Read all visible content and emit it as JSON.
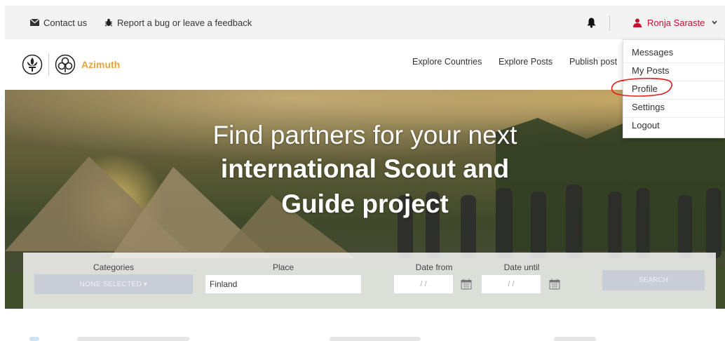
{
  "topbar": {
    "contact_label": "Contact us",
    "bug_label": "Report a bug or leave a feedback",
    "user_name": "Ronja Saraste"
  },
  "navbar": {
    "brand": "Azimuth",
    "links": [
      "Explore Countries",
      "Explore Posts",
      "Publish post"
    ]
  },
  "hero": {
    "line1": "Find partners for your next",
    "line2": "international Scout and",
    "line3": "Guide project"
  },
  "search": {
    "categories_label": "Categories",
    "categories_value": "NONE SELECTED ▾",
    "place_label": "Place",
    "place_value": "Finland",
    "date_from_label": "Date from",
    "date_until_label": "Date until",
    "date_placeholder": "/ /",
    "search_button": "SEARCH"
  },
  "user_menu": {
    "items": [
      "Messages",
      "My Posts",
      "Profile",
      "Settings",
      "Logout"
    ]
  },
  "colors": {
    "accent": "#c8102e",
    "brand": "#e8a23a",
    "annotation": "#e21b1b"
  }
}
